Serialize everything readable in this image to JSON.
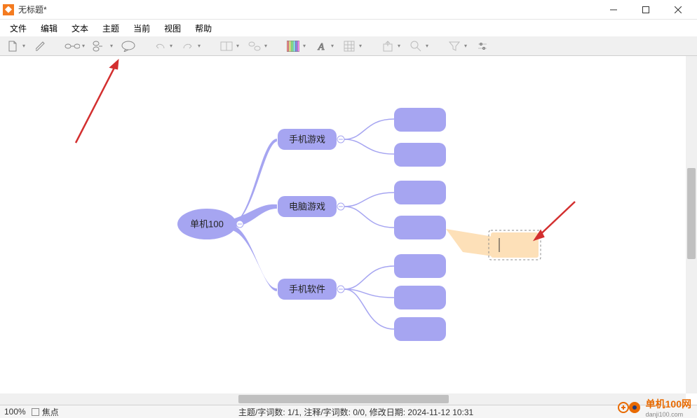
{
  "window": {
    "title": "无标题*"
  },
  "menu": {
    "file": "文件",
    "edit": "编辑",
    "text": "文本",
    "topic": "主题",
    "current": "当前",
    "view": "视图",
    "help": "帮助"
  },
  "mindmap": {
    "root": "单机100",
    "branch1": "手机游戏",
    "branch2": "电脑游戏",
    "branch3": "手机软件",
    "comment_editing": ""
  },
  "statusbar": {
    "zoom": "100%",
    "focus_label": "焦点",
    "stats": "主题/字词数: 1/1, 注释/字词数: 0/0, 修改日期: 2024-11-12 10:31"
  },
  "watermark": {
    "name": "单机100网",
    "domain": "danji100.com"
  },
  "colors": {
    "node": "#A6A5F1",
    "comment": "#FDE0B8",
    "arrow": "#D32F2F"
  }
}
